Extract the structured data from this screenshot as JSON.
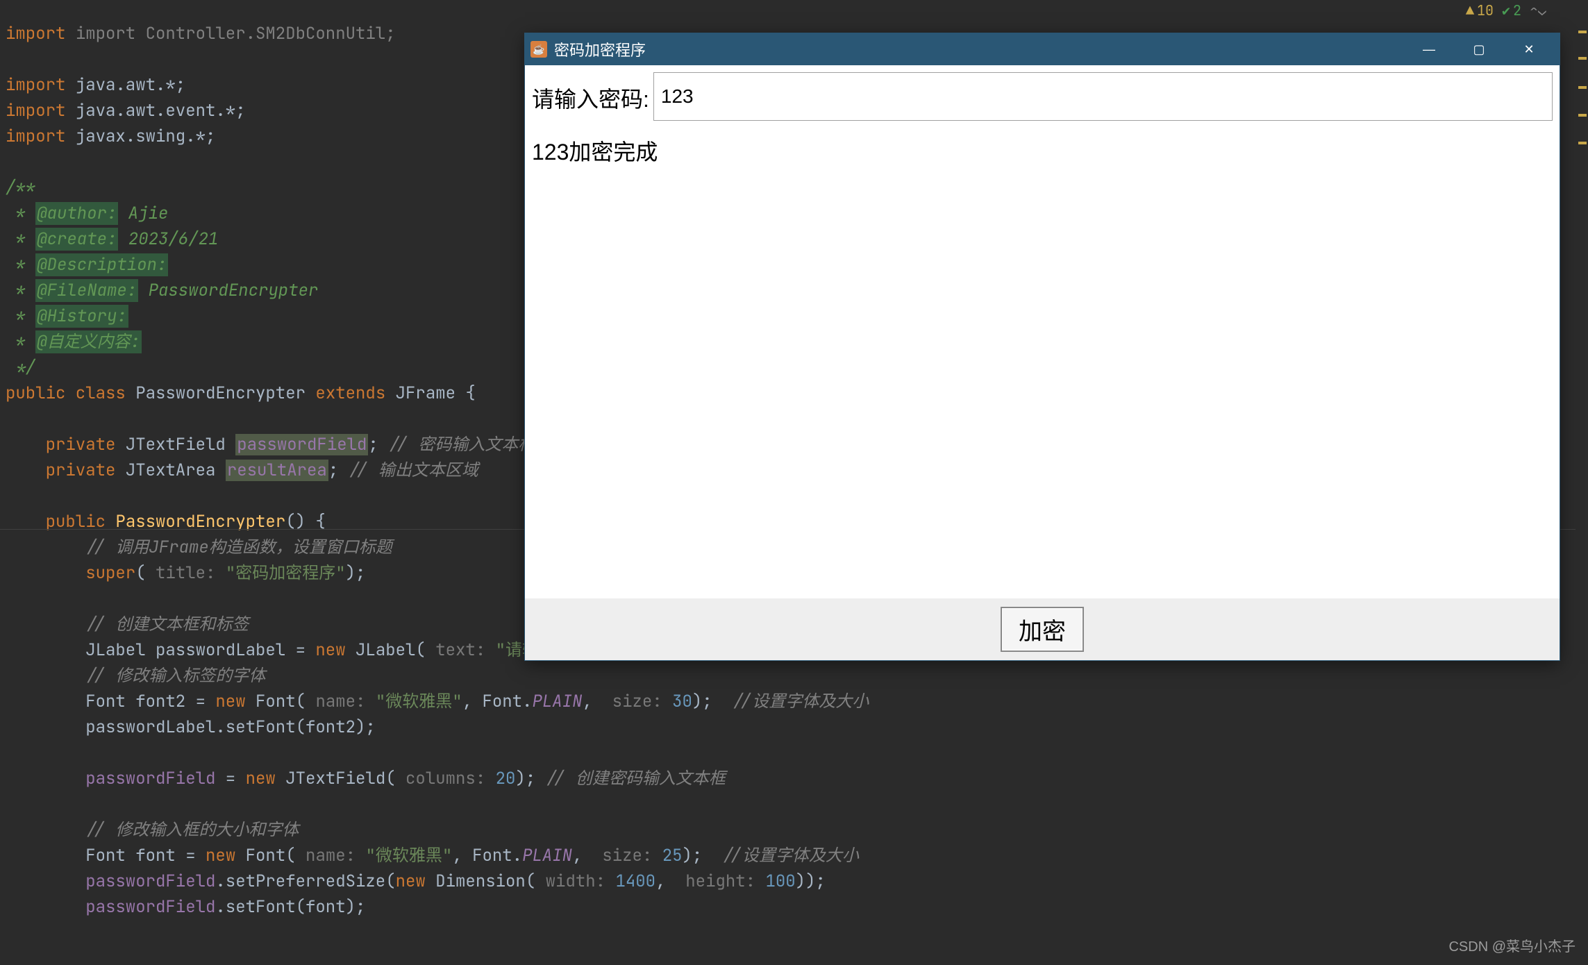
{
  "ide": {
    "warnings_count": "10",
    "checks_count": "2",
    "code": {
      "l1": "import Controller.SM2DbConnUtil;",
      "l3_kw": "import",
      "l3_rest": " java.awt.*;",
      "l4_kw": "import",
      "l4_rest": " java.awt.event.*;",
      "l5_kw": "import",
      "l5_rest": " javax.swing.*;",
      "doc_open": "/**",
      "doc_author_tag": "@author:",
      "doc_author_val": " Ajie",
      "doc_create_tag": "@create:",
      "doc_create_val": " 2023/6/21",
      "doc_desc_tag": "@Description:",
      "doc_file_tag": "@FileName:",
      "doc_file_val": " Password",
      "doc_file_val2": "Encrypter",
      "doc_hist_tag": "@History:",
      "doc_custom_tag": "@自定义内容:",
      "doc_close": " */",
      "cls_public": "public class ",
      "cls_name": "Password",
      "cls_name2": "Encrypter",
      "cls_ext": " extends ",
      "cls_frame": "JFrame",
      "cls_brace": " {",
      "f1_priv": "private ",
      "f1_type": "JTextField ",
      "f1_name": "passwordField",
      "f1_semi": ";",
      "f1_cmt": " // 密码输入文本框",
      "f2_priv": "private ",
      "f2_type": "JTextArea ",
      "f2_name": "resultArea",
      "f2_semi": ";",
      "f2_cmt": " // 输出文本区域",
      "ctor_public": "public ",
      "ctor_name": "PasswordEncrypter",
      "ctor_rest": "() {",
      "cmt1": "// 调用JFrame构造函数，设置窗口标题",
      "super_kw": "super",
      "super_open": "( ",
      "super_hint": "title: ",
      "super_str": "\"密码加密程序\"",
      "super_close": ");",
      "cmt2": "// 创建文本框和标签",
      "lbl_type": "JLabel passwordLabel = ",
      "lbl_new": "new ",
      "lbl_cls": "JLabel",
      "lbl_open": "( ",
      "lbl_hint": "text: ",
      "lbl_str": "\"请输入密码:\"",
      "lbl_close": ");",
      "cmt3": "// 修改输入标签的字体",
      "font2_decl": "Font font2 = ",
      "font2_new": "new ",
      "font2_cls": "Font",
      "font2_open": "( ",
      "font2_hint1": "name: ",
      "font2_str": "\"微软雅黑\"",
      "font2_mid": ", Font.",
      "font2_plain": "PLAIN",
      "font2_c": ",  ",
      "font2_hint2": "size: ",
      "font2_num": "30",
      "font2_close": ");  ",
      "font2_cmt": "//设置字体及大小",
      "setfont2": "passwordLabel.setFont(font2);",
      "pf_assign": "passwordField",
      "pf_eq": " = ",
      "pf_new": "new ",
      "pf_cls": "JTextField",
      "pf_open": "( ",
      "pf_hint": "columns: ",
      "pf_num": "20",
      "pf_close": "); ",
      "pf_cmt": "// 创建密码输入文本框",
      "cmt4": "// 修改输入框的大小和字体",
      "font_decl": "Font font = ",
      "font_new": "new ",
      "font_cls": "Font",
      "font_open": "( ",
      "font_hint1": "name: ",
      "font_str": "\"微软雅黑\"",
      "font_mid": ", Font.",
      "font_plain": "PLAIN",
      "font_c": ",  ",
      "font_hint2": "size: ",
      "font_num": "25",
      "font_close": ");  ",
      "font_cmt": "//设置字体及大小",
      "setsize_field": "passwordField",
      "setsize_call": ".setPreferredSize(",
      "setsize_new": "new ",
      "setsize_cls": "Dimension",
      "setsize_open": "( ",
      "setsize_hint1": "width: ",
      "setsize_n1": "1400",
      "setsize_c": ",  ",
      "setsize_hint2": "height: ",
      "setsize_n2": "100",
      "setsize_close": "));",
      "setfont_field": "passwordField",
      "setfont_call": ".setFont(font);"
    }
  },
  "swing": {
    "window_title": "密码加密程序",
    "password_label": "请输入密码:",
    "password_value": "123",
    "result_text": "123加密完成",
    "encrypt_button": "加密"
  },
  "watermark": "CSDN @菜鸟小杰子"
}
